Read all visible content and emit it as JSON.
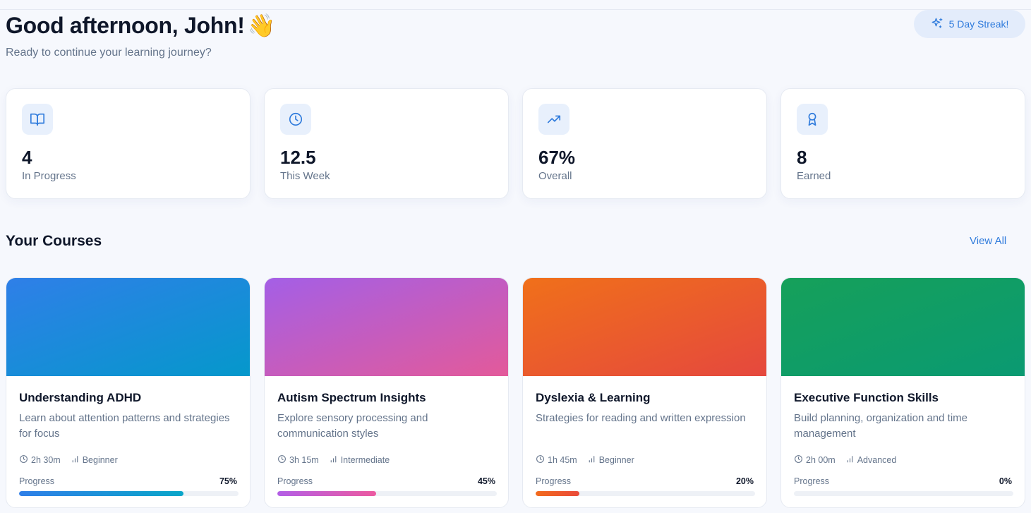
{
  "header": {
    "greeting": "Good afternoon, John!",
    "wave_emoji": "👋",
    "subtitle": "Ready to continue your learning journey?",
    "streak_label": "5 Day Streak!",
    "streak_icon": "sparkles-icon"
  },
  "stats": [
    {
      "icon": "book-open-icon",
      "value": "4",
      "label": "In Progress"
    },
    {
      "icon": "clock-icon",
      "value": "12.5",
      "label": "This Week"
    },
    {
      "icon": "trending-up-icon",
      "value": "67%",
      "label": "Overall"
    },
    {
      "icon": "award-icon",
      "value": "8",
      "label": "Earned"
    }
  ],
  "courses_section": {
    "title": "Your Courses",
    "view_all_label": "View All"
  },
  "courses": [
    {
      "title": "Understanding ADHD",
      "description": "Learn about attention patterns and strategies for focus",
      "duration": "2h 30m",
      "level": "Beginner",
      "progress_label": "Progress",
      "progress_text": "75%",
      "progress": 0.75,
      "banner_colors": [
        "#2f7fe8",
        "#0598cb"
      ],
      "bar_colors": [
        "#2f7fe8",
        "#0aa6c9"
      ]
    },
    {
      "title": "Autism Spectrum Insights",
      "description": "Explore sensory processing and communication styles",
      "duration": "3h 15m",
      "level": "Intermediate",
      "progress_label": "Progress",
      "progress_text": "45%",
      "progress": 0.45,
      "banner_colors": [
        "#a45fe6",
        "#e35a9a"
      ],
      "bar_colors": [
        "#b35ee6",
        "#ec5aa0"
      ]
    },
    {
      "title": "Dyslexia & Learning",
      "description": "Strategies for reading and written expression",
      "duration": "1h 45m",
      "level": "Beginner",
      "progress_label": "Progress",
      "progress_text": "20%",
      "progress": 0.2,
      "banner_colors": [
        "#f0701a",
        "#e5483e"
      ],
      "bar_colors": [
        "#f26b1c",
        "#ea4a3a"
      ]
    },
    {
      "title": "Executive Function Skills",
      "description": "Build planning, organization and time management",
      "duration": "2h 00m",
      "level": "Advanced",
      "progress_label": "Progress",
      "progress_text": "0%",
      "progress": 0.0,
      "banner_colors": [
        "#16a05a",
        "#0a9a72"
      ],
      "bar_colors": [
        "#16a05a",
        "#0a9a72"
      ]
    }
  ]
}
